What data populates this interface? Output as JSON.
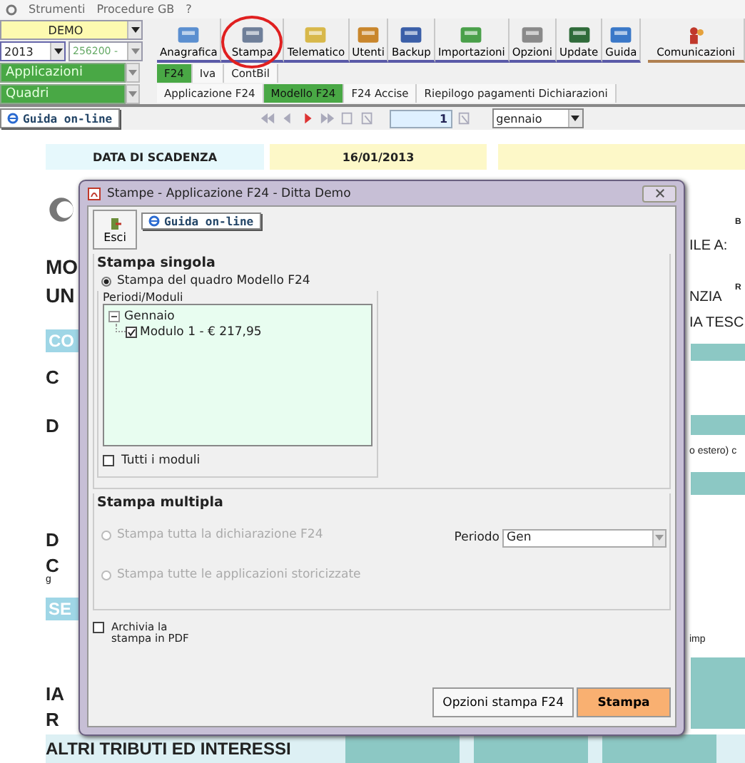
{
  "menu": [
    "Strumenti",
    "Procedure GB",
    "?"
  ],
  "left_panel": {
    "company": "DEMO",
    "year": "2013",
    "code": "256200 -",
    "applications": {
      "placeholder": "Applicazioni"
    },
    "sections": {
      "placeholder": "Quadri"
    }
  },
  "toolbar": [
    {
      "label": "Anagrafica",
      "circled": false
    },
    {
      "label": "Stampa",
      "circled": true
    },
    {
      "label": "Telematico",
      "circled": false
    },
    {
      "label": "Utenti",
      "circled": false
    },
    {
      "label": "Backup",
      "circled": false
    },
    {
      "label": "Importazioni",
      "circled": false
    },
    {
      "label": "Opzioni",
      "circled": false
    },
    {
      "label": "Update",
      "circled": false
    },
    {
      "label": "Guida",
      "circled": false
    }
  ],
  "communications": "Comunicazioni",
  "tabs": [
    {
      "label": "F24",
      "selected": true
    },
    {
      "label": "Iva",
      "selected": false
    },
    {
      "label": "ContBil",
      "selected": false
    }
  ],
  "subtabs": [
    {
      "label": "Applicazione F24",
      "selected": false
    },
    {
      "label": "Modello F24",
      "selected": true
    },
    {
      "label": "F24 Accise",
      "selected": false
    },
    {
      "label": "Riepilogo pagamenti Dichiarazioni",
      "selected": false
    }
  ],
  "nav": {
    "help": "Guida on-line",
    "page": "1",
    "month": "gennaio"
  },
  "form": {
    "due_label": "DATA DI SCADENZA",
    "due_date": "16/01/2013",
    "left_fragments": [
      {
        "text": "MO",
        "kind": "title"
      },
      {
        "text": "UN",
        "kind": "title"
      },
      {
        "text": "CO",
        "kind": "band"
      },
      {
        "text": "C",
        "kind": "label"
      },
      {
        "text": "D",
        "kind": "label"
      },
      {
        "text": "D",
        "kind": "label"
      },
      {
        "text": "C",
        "kind": "label"
      },
      {
        "text": "g",
        "kind": "small"
      },
      {
        "text": "SE",
        "kind": "band"
      },
      {
        "text": "IA",
        "kind": "label"
      },
      {
        "text": "R",
        "kind": "label"
      }
    ],
    "right_fragments": [
      {
        "text": "B",
        "kind": "tiny"
      },
      {
        "text": "ILE A:",
        "kind": "title"
      },
      {
        "text": "R",
        "kind": "tiny"
      },
      {
        "text": "NZIA",
        "kind": "title"
      },
      {
        "text": "IA TESC",
        "kind": "title"
      },
      {
        "text": "o estero) c",
        "kind": "small"
      },
      {
        "text": "imp",
        "kind": "small"
      }
    ],
    "footer": "ALTRI TRIBUTI ED INTERESSI"
  },
  "dialog": {
    "title": "Stampe - Applicazione F24 - Ditta  Demo",
    "exit": "Esci",
    "help": "Guida on-line",
    "single": {
      "title": "Stampa singola",
      "option": {
        "label": "Stampa del quadro Modello F24",
        "selected": true
      },
      "periods": {
        "title": "Periodi/Moduli",
        "tree": [
          {
            "label": "Gennaio",
            "expanded": true,
            "children": [
              {
                "label": "Modulo 1 - € 217,95",
                "checked": true
              }
            ]
          }
        ],
        "all": {
          "label": "Tutti i moduli",
          "checked": false
        }
      }
    },
    "multiple": {
      "title": "Stampa multipla",
      "options": [
        {
          "label": "Stampa tutta la dichiarazione F24",
          "selected": false,
          "disabled": true
        },
        {
          "label": "Stampa tutte le applicazioni storicizzate",
          "selected": false,
          "disabled": true
        }
      ],
      "period_label": "Periodo",
      "period": "Gen"
    },
    "archive": {
      "label": "Archivia la stampa in PDF",
      "checked": false
    },
    "buttons": [
      {
        "label": "Opzioni stampa F24",
        "kind": "default"
      },
      {
        "label": "Stampa",
        "kind": "primary"
      }
    ]
  }
}
